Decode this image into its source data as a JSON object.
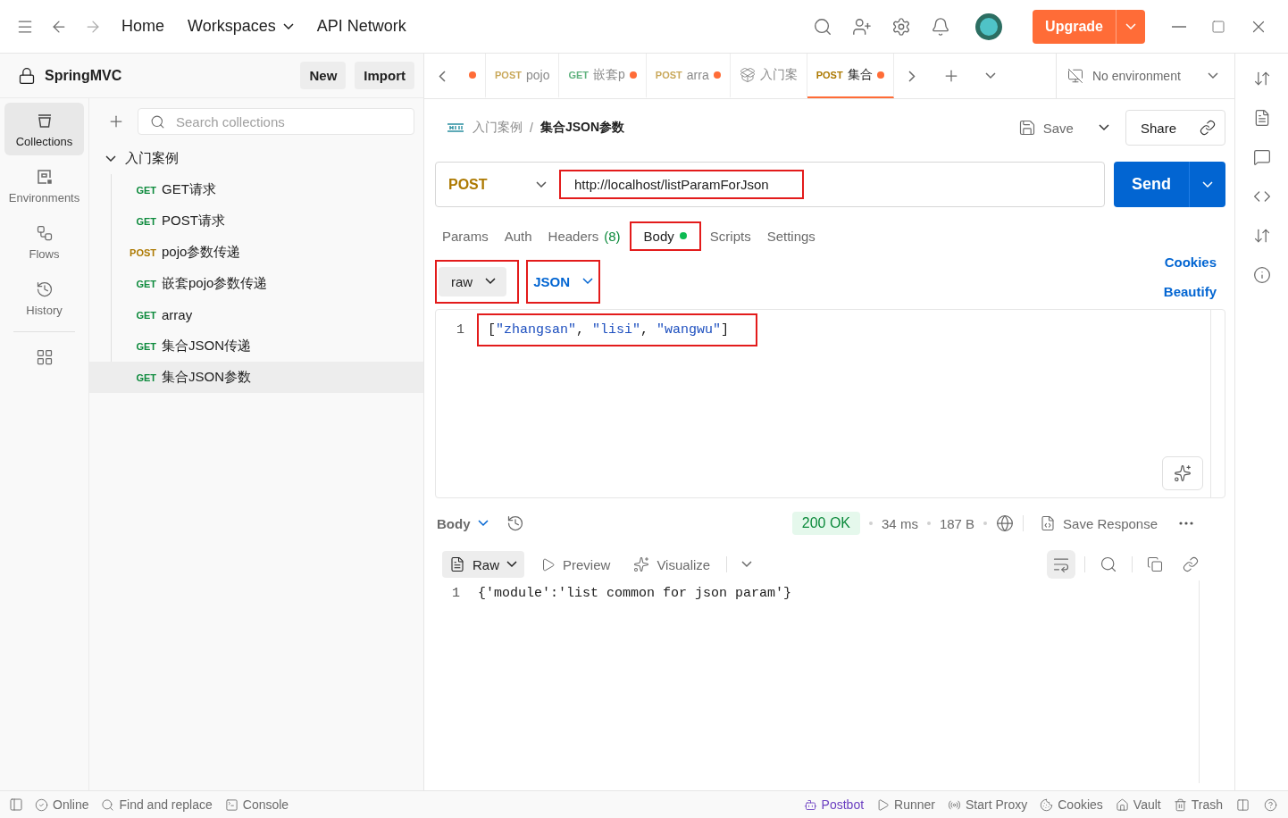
{
  "top_bar": {
    "nav": [
      {
        "label": "Home",
        "dropdown": false
      },
      {
        "label": "Workspaces",
        "dropdown": true
      },
      {
        "label": "API Network",
        "dropdown": false
      }
    ],
    "upgrade": "Upgrade"
  },
  "sidebar": {
    "workspace": "SpringMVC",
    "buttons": [
      "New",
      "Import"
    ],
    "rail": [
      {
        "kind": "collections",
        "label": "Collections",
        "selected": true
      },
      {
        "kind": "environments",
        "label": "Environments",
        "selected": false
      },
      {
        "kind": "flows",
        "label": "Flows",
        "selected": false
      },
      {
        "kind": "history",
        "label": "History",
        "selected": false
      }
    ],
    "search": {
      "placeholder": "Search collections"
    },
    "tree": {
      "label": "入门案例",
      "expanded": true,
      "children": [
        {
          "method": "GET",
          "label": "GET请求",
          "selected": false
        },
        {
          "method": "GET",
          "label": "POST请求",
          "selected": false
        },
        {
          "method": "POST",
          "label": "pojo参数传递",
          "selected": false
        },
        {
          "method": "GET",
          "label": "嵌套pojo参数传递",
          "selected": false
        },
        {
          "method": "GET",
          "label": "array",
          "selected": false
        },
        {
          "method": "GET",
          "label": "集合JSON传递",
          "selected": false
        },
        {
          "method": "GET",
          "label": "集合JSON参数",
          "selected": true
        }
      ]
    }
  },
  "tabs": [
    {
      "kind": "request",
      "dirty": true,
      "selected": false
    },
    {
      "kind": "request",
      "method": "POST",
      "label": "pojo",
      "dirty": false,
      "selected": false
    },
    {
      "kind": "request",
      "method": "GET",
      "label": "嵌套p",
      "dirty": true,
      "selected": false
    },
    {
      "kind": "request",
      "method": "POST",
      "label": "arra",
      "dirty": true,
      "selected": false
    },
    {
      "kind": "collection",
      "label": "入门案",
      "dirty": false,
      "selected": false
    },
    {
      "kind": "request",
      "method": "POST",
      "label": "集合",
      "dirty": true,
      "selected": true
    }
  ],
  "environment": "No environment",
  "request": {
    "breadcrumb": [
      "入门案例",
      "集合JSON参数"
    ],
    "breadcrumb_separator": "/",
    "save": "Save",
    "share": "Share",
    "method": "POST",
    "url": {
      "value": "http://localhost/listParamForJson",
      "highlighted": true
    },
    "send": "Send",
    "sections": [
      {
        "label": "Params",
        "selected": false,
        "highlighted": false
      },
      {
        "label": "Auth",
        "selected": false,
        "highlighted": false
      },
      {
        "label": "Headers",
        "count": "(8)",
        "selected": false,
        "highlighted": false
      },
      {
        "label": "Body",
        "dot": true,
        "selected": true,
        "highlighted": true
      },
      {
        "label": "Scripts",
        "selected": false,
        "highlighted": false
      },
      {
        "label": "Settings",
        "selected": false,
        "highlighted": false
      }
    ],
    "cookies": "Cookies",
    "body_mode": {
      "value": "raw",
      "highlighted": true
    },
    "body_format": {
      "value": "JSON",
      "highlighted": true
    },
    "beautify": "Beautify",
    "editor_lines": [
      {
        "number": "1",
        "code": "[\"zhangsan\", \"lisi\", \"wangwu\"]",
        "highlighted": true
      }
    ]
  },
  "response": {
    "view": "Body",
    "status": "200 OK",
    "time": "34 ms",
    "size": "187 B",
    "save_response": "Save Response",
    "format": "Raw",
    "preview": "Preview",
    "visualize": "Visualize",
    "lines": [
      {
        "number": "1",
        "code": "{'module':'list common for json param'}"
      }
    ]
  },
  "status_bar": {
    "left": [
      {
        "kind": "online",
        "label": "Online"
      },
      {
        "kind": "find",
        "label": "Find and replace"
      },
      {
        "kind": "console",
        "label": "Console"
      }
    ],
    "right": [
      {
        "kind": "postbot",
        "label": "Postbot"
      },
      {
        "kind": "runner",
        "label": "Runner"
      },
      {
        "kind": "proxy",
        "label": "Start Proxy"
      },
      {
        "kind": "cookies",
        "label": "Cookies"
      },
      {
        "kind": "vault",
        "label": "Vault"
      },
      {
        "kind": "trash",
        "label": "Trash"
      }
    ]
  }
}
